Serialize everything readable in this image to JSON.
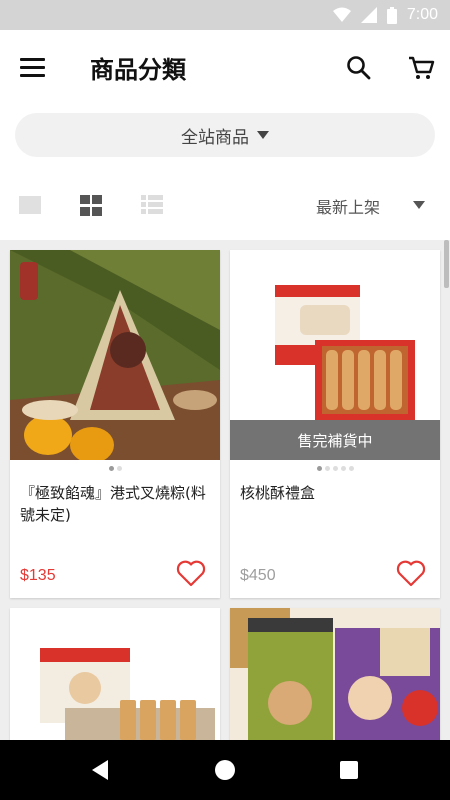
{
  "status_bar": {
    "time": "7:00"
  },
  "header": {
    "title": "商品分類"
  },
  "filter": {
    "label": "全站商品"
  },
  "sort": {
    "label": "最新上架"
  },
  "products": [
    {
      "name": "『極致餡魂』港式叉燒粽(料號未定)",
      "price": "$135",
      "price_color": "#e53935",
      "sold_out": false
    },
    {
      "name": "核桃酥禮盒",
      "price": "$450",
      "price_color": "#9e9e9e",
      "sold_out": true,
      "sold_out_label": "售完補貨中"
    }
  ],
  "colors": {
    "accent": "#e53935",
    "muted_price": "#9e9e9e"
  },
  "icons": {
    "menu": "hamburger",
    "search": "magnifier",
    "cart": "cart",
    "favorite": "heart-outline"
  }
}
